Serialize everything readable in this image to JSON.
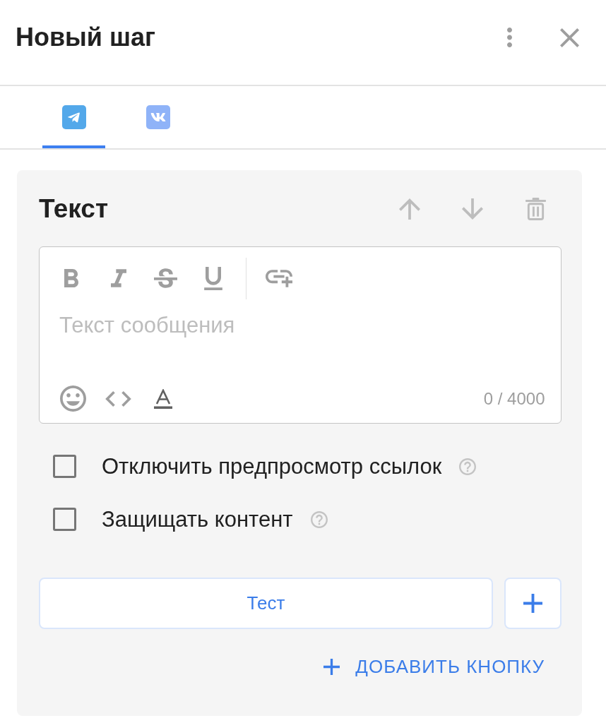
{
  "header": {
    "title": "Новый шаг"
  },
  "tabs": [
    {
      "kind": "telegram",
      "selected": true
    },
    {
      "kind": "vk",
      "selected": false
    }
  ],
  "block": {
    "title": "Текст",
    "editor": {
      "placeholder": "Текст сообщения",
      "counter": "0 / 4000"
    },
    "options": [
      {
        "label": "Отключить предпросмотр ссылок",
        "checked": false
      },
      {
        "label": "Защищать контент",
        "checked": false
      }
    ],
    "buttons": [
      {
        "label": "Тест"
      }
    ],
    "add_button": "ДОБАВИТЬ КНОПКУ"
  }
}
